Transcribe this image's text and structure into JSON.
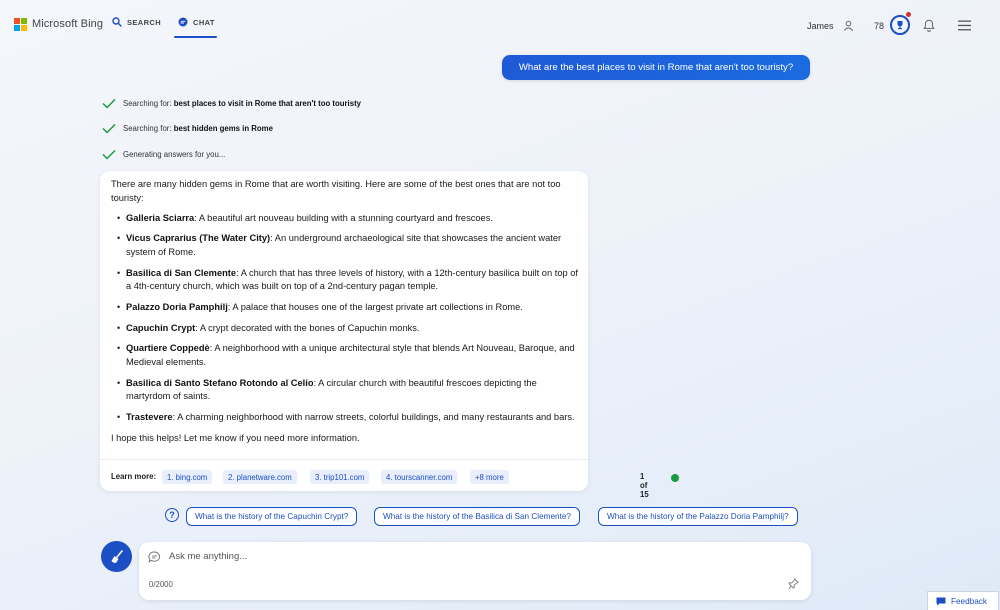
{
  "header": {
    "logo_text": "Microsoft Bing",
    "tabs": [
      {
        "label": "SEARCH",
        "icon": "search-icon"
      },
      {
        "label": "CHAT",
        "icon": "chat-icon",
        "active": true
      }
    ],
    "user_name": "James",
    "points": "78",
    "colors": {
      "accent": "#1d4fc4",
      "notification": "#d32f2f",
      "ms_red": "#f25022",
      "ms_green": "#7fba00",
      "ms_blue": "#00a4ef",
      "ms_yellow": "#ffb900"
    }
  },
  "user_message": "What are the best places to visit in Rome that aren't too touristy?",
  "status": [
    {
      "prefix": "Searching for: ",
      "query": "best places to visit in Rome that aren't too touristy"
    },
    {
      "prefix": "Searching for: ",
      "query": "best hidden gems in Rome"
    },
    {
      "prefix": "Generating answers for you...",
      "query": ""
    }
  ],
  "answer": {
    "intro": "There are many hidden gems in Rome that are worth visiting. Here are some of the best ones that are not too touristy:",
    "items": [
      {
        "name": "Galleria Sciarra",
        "desc": ": A beautiful art nouveau building with a stunning courtyard and frescoes."
      },
      {
        "name": "Vicus Caprarius (The Water City)",
        "desc": ": An underground archaeological site that showcases the ancient water system of Rome."
      },
      {
        "name": "Basilica di San Clemente",
        "desc": ": A church that has three levels of history, with a 12th-century basilica built on top of a 4th-century church, which was built on top of a 2nd-century pagan temple."
      },
      {
        "name": "Palazzo Doria Pamphilj",
        "desc": ": A palace that houses one of the largest private art collections in Rome."
      },
      {
        "name": "Capuchin Crypt",
        "desc": ": A crypt decorated with the bones of Capuchin monks."
      },
      {
        "name": "Quartiere Coppedè",
        "desc": ": A neighborhood with a unique architectural style that blends Art Nouveau, Baroque, and Medieval elements."
      },
      {
        "name": "Basilica di Santo Stefano Rotondo al Celio",
        "desc": ": A circular church with beautiful frescoes depicting the martyrdom of saints."
      },
      {
        "name": "Trastevere",
        "desc": ": A charming neighborhood with narrow streets, colorful buildings, and many restaurants and bars."
      }
    ],
    "outro": "I hope this helps! Let me know if you need more information.",
    "learn_more_label": "Learn more:",
    "sources": [
      "1. bing.com",
      "2. planetware.com",
      "3. trip101.com",
      "4. tourscanner.com",
      "+8 more"
    ],
    "page_count": "1 of 15"
  },
  "suggestions": [
    "What is the history of the Capuchin Crypt?",
    "What is the history of the Basilica di San Clemente?",
    "What is the history of the Palazzo Doria Pamphilj?"
  ],
  "input": {
    "placeholder": "Ask me anything...",
    "value": "",
    "char_count": "0/2000"
  },
  "feedback_label": "Feedback"
}
